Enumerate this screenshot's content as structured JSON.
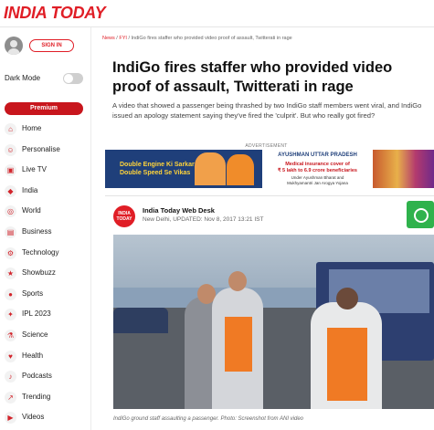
{
  "header": {
    "logo_text": "INDIA TODAY"
  },
  "sidebar": {
    "signin_label": "SIGN IN",
    "dark_mode_label": "Dark Mode",
    "premium_label": "Premium",
    "items": [
      {
        "label": "Home",
        "icon": "home-icon"
      },
      {
        "label": "Personalise",
        "icon": "personalise-icon"
      },
      {
        "label": "Live TV",
        "icon": "live-tv-icon"
      },
      {
        "label": "India",
        "icon": "india-icon"
      },
      {
        "label": "World",
        "icon": "globe-icon"
      },
      {
        "label": "Business",
        "icon": "business-icon"
      },
      {
        "label": "Technology",
        "icon": "technology-icon"
      },
      {
        "label": "Showbuzz",
        "icon": "showbuzz-icon"
      },
      {
        "label": "Sports",
        "icon": "sports-icon"
      },
      {
        "label": "IPL 2023",
        "icon": "ipl-icon"
      },
      {
        "label": "Science",
        "icon": "science-icon"
      },
      {
        "label": "Health",
        "icon": "health-icon"
      },
      {
        "label": "Podcasts",
        "icon": "podcasts-icon"
      },
      {
        "label": "Trending",
        "icon": "trending-icon"
      },
      {
        "label": "Videos",
        "icon": "videos-icon"
      }
    ]
  },
  "article": {
    "breadcrumb": {
      "part1": "News",
      "sep": " / ",
      "part2": "FYI",
      "part3": "IndiGo fires staffer who provided video proof of assault, Twitterati in rage"
    },
    "headline": "IndiGo fires staffer who provided video proof of assault, Twitterati in rage",
    "summary": "A video that showed a passenger being thrashed by two IndiGo staff members went viral, and IndiGo issued an apology statement saying they've fired the 'culprit'. But who really got fired?",
    "advertisement_label": "ADVERTISEMENT",
    "ad": {
      "left_line1": "Double Engine Ki Sarkar",
      "left_line2": "Double Speed Se Vikas",
      "mid_title": "AYUSHMAN UTTAR PRADESH",
      "mid_line1": "Medical insurance cover of",
      "mid_line2": "₹ 5 lakh to 6.9 crore beneficiaries",
      "mid_line3": "Under Ayushman Bharat and",
      "mid_line4": "Mukhyamantri Jan Arogya Yojana"
    },
    "author_logo_line1": "INDIA",
    "author_logo_line2": "TODAY",
    "author_name": "India Today Web Desk",
    "author_meta": "New Delhi, UPDATED: Nov 8, 2017 13:21 IST",
    "photo_caption": "IndiGo ground staff assaulting a passenger. Photo: Screenshot from ANI video"
  },
  "colors": {
    "brand_red": "#e01e26",
    "whatsapp_green": "#2fb24c"
  }
}
